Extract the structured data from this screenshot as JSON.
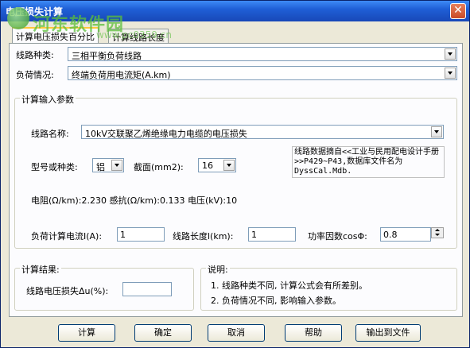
{
  "window": {
    "title": "电压损失计算",
    "close_label": "✕"
  },
  "watermark": {
    "text": "河东软件园",
    "url": "www.pc0359.cn"
  },
  "tabs": [
    {
      "label": "计算电压损失百分比",
      "active": true
    },
    {
      "label": "计算线路长度",
      "active": false
    }
  ],
  "line_type": {
    "label": "线路种类:",
    "value": "三相平衡负荷线路"
  },
  "load_condition": {
    "label": "负荷情况:",
    "value": "终端负荷用电流矩(A.km)"
  },
  "input_params": {
    "title": "计算输入参数",
    "line_name_label": "线路名称:",
    "line_name_value": "10kV交联聚乙烯绝缘电力电缆的电压损失",
    "model_label": "型号或种类:",
    "model_value": "铝",
    "section_label": "截面(mm2):",
    "section_value": "16",
    "note_text": "线路数据摘自<<工业与民用配电设计手册>>P429~P43,数据库文件名为DyssCal.Mdb.",
    "resistance_text": "电阻(Ω/km):2.230  感抗(Ω/km):0.133  电压(kV):10",
    "current_label": "负荷计算电流I(A):",
    "current_value": "1",
    "length_label": "线路长度l(km):",
    "length_value": "1",
    "power_factor_label": "功率因数cosΦ:",
    "power_factor_value": "0.8"
  },
  "result": {
    "title": "计算结果:",
    "loss_label": "线路电压损失Δu(%):",
    "loss_value": ""
  },
  "explanation": {
    "title": "说明:",
    "line1": "1. 线路种类不同, 计算公式会有所差别。",
    "line2": "2. 负荷情况不同, 影响输入参数。"
  },
  "buttons": {
    "calculate": "计算",
    "ok": "确定",
    "cancel": "取消",
    "help": "帮助",
    "export": "输出到文件"
  },
  "colors": {
    "titlebar": "#1f5fd6",
    "dialog_bg": "#ece9d8",
    "watermark": "#5bbf3a"
  }
}
